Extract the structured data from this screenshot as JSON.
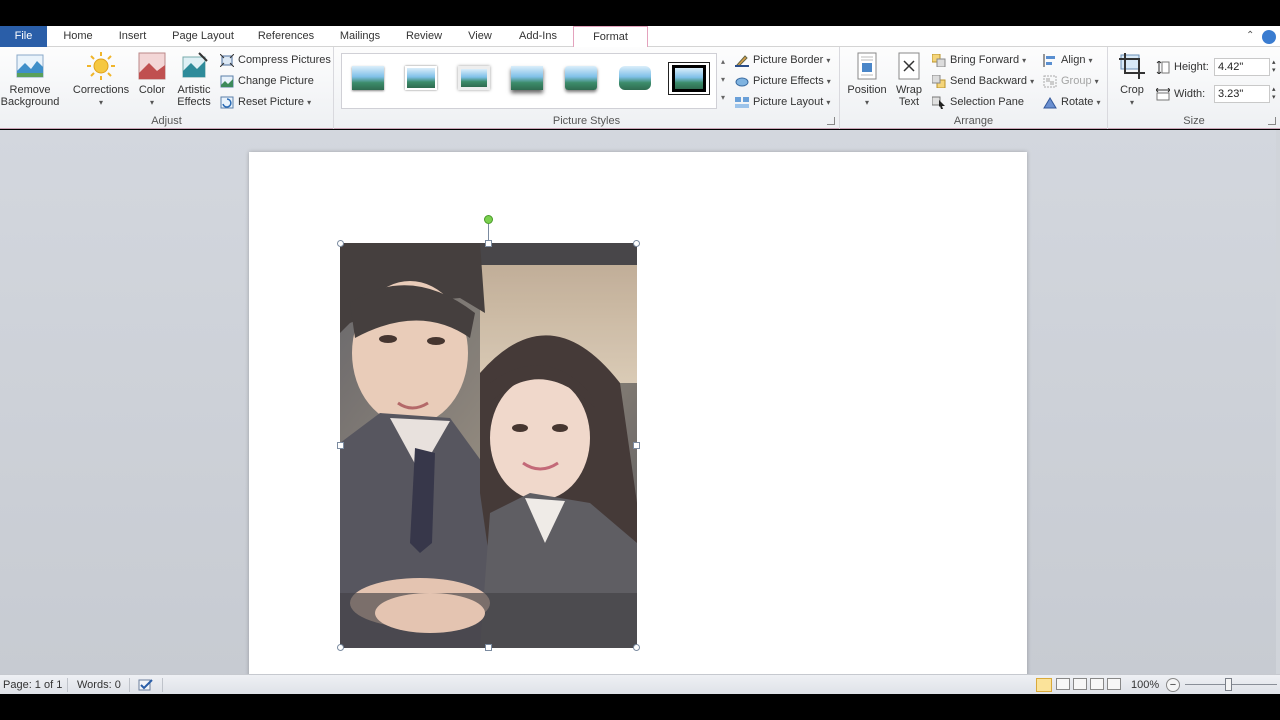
{
  "tabs": {
    "file": "File",
    "home": "Home",
    "insert": "Insert",
    "page_layout": "Page Layout",
    "references": "References",
    "mailings": "Mailings",
    "review": "Review",
    "view": "View",
    "add_ins": "Add-Ins",
    "format": "Format"
  },
  "ribbon": {
    "adjust": {
      "label": "Adjust",
      "remove_background_line1": "Remove",
      "remove_background_line2": "Background",
      "corrections": "Corrections",
      "color": "Color",
      "artistic_line1": "Artistic",
      "artistic_line2": "Effects",
      "compress": "Compress Pictures",
      "change": "Change Picture",
      "reset": "Reset Picture"
    },
    "picture_styles": {
      "label": "Picture Styles",
      "border": "Picture Border",
      "effects": "Picture Effects",
      "layout": "Picture Layout"
    },
    "arrange": {
      "label": "Arrange",
      "position": "Position",
      "wrap_line1": "Wrap",
      "wrap_line2": "Text",
      "bring_forward": "Bring Forward",
      "send_backward": "Send Backward",
      "selection_pane": "Selection Pane",
      "align": "Align",
      "group": "Group",
      "rotate": "Rotate"
    },
    "size": {
      "label": "Size",
      "crop": "Crop",
      "height_label": "Height:",
      "height_value": "4.42\"",
      "width_label": "Width:",
      "width_value": "3.23\""
    }
  },
  "status": {
    "page": "Page: 1 of 1",
    "words": "Words: 0",
    "zoom": "100%"
  },
  "colors": {
    "file_tab": "#2a5ea8",
    "format_tab_border": "#e4a2bd",
    "selection_handle_border": "#7b8ba0",
    "rotate_handle": "#7ad04e"
  }
}
